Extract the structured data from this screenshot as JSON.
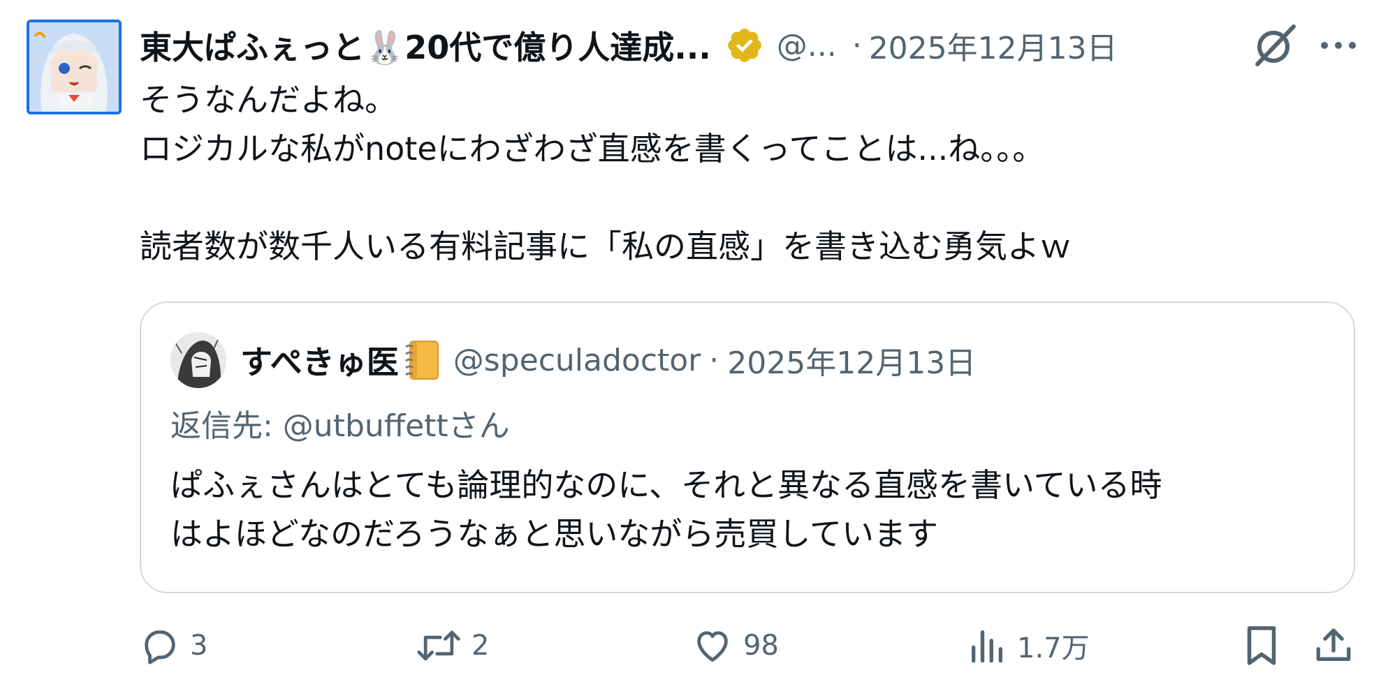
{
  "tweet": {
    "display_name": "東大ぱふぇっと🐰20代で億り人達成...",
    "handle": "@...",
    "separator": "·",
    "date": "2025年12月13日",
    "body_lines": [
      "そうなんだよね。",
      "ロジカルな私がnoteにわざわざ直感を書くってことは...ね。。。",
      "",
      "読者数が数千人いる有料記事に「私の直感」を書き込む勇気よｗ"
    ],
    "icons": {
      "avatar": "anime-character-avatar",
      "verified": "gold-verified-badge-icon",
      "grok": "grok-icon",
      "more": "more-options-icon"
    },
    "colors": {
      "verified_gold": "#e2b719",
      "secondary_text": "#536471",
      "avatar_border": "#1d6fe8",
      "card_border": "#cfd9de"
    }
  },
  "quote": {
    "display_name": "すぺきゅ医",
    "name_emoji": "notebook-icon",
    "handle": "@speculadoctor",
    "separator": "·",
    "date": "2025年12月13日",
    "reply_to": "返信先: @utbuffettさん",
    "text_lines": [
      "ぱふぇさんはとても論理的なのに、それと異なる直感を書いている時",
      "はよほどなのだろうなぁと思いながら売買しています"
    ]
  },
  "actions": {
    "reply": {
      "icon": "reply-icon",
      "count": "3"
    },
    "repost": {
      "icon": "repost-icon",
      "count": "2"
    },
    "like": {
      "icon": "heart-icon",
      "count": "98"
    },
    "views": {
      "icon": "views-icon",
      "count": "1.7万"
    },
    "bookmark": {
      "icon": "bookmark-icon"
    },
    "share": {
      "icon": "share-icon"
    }
  }
}
